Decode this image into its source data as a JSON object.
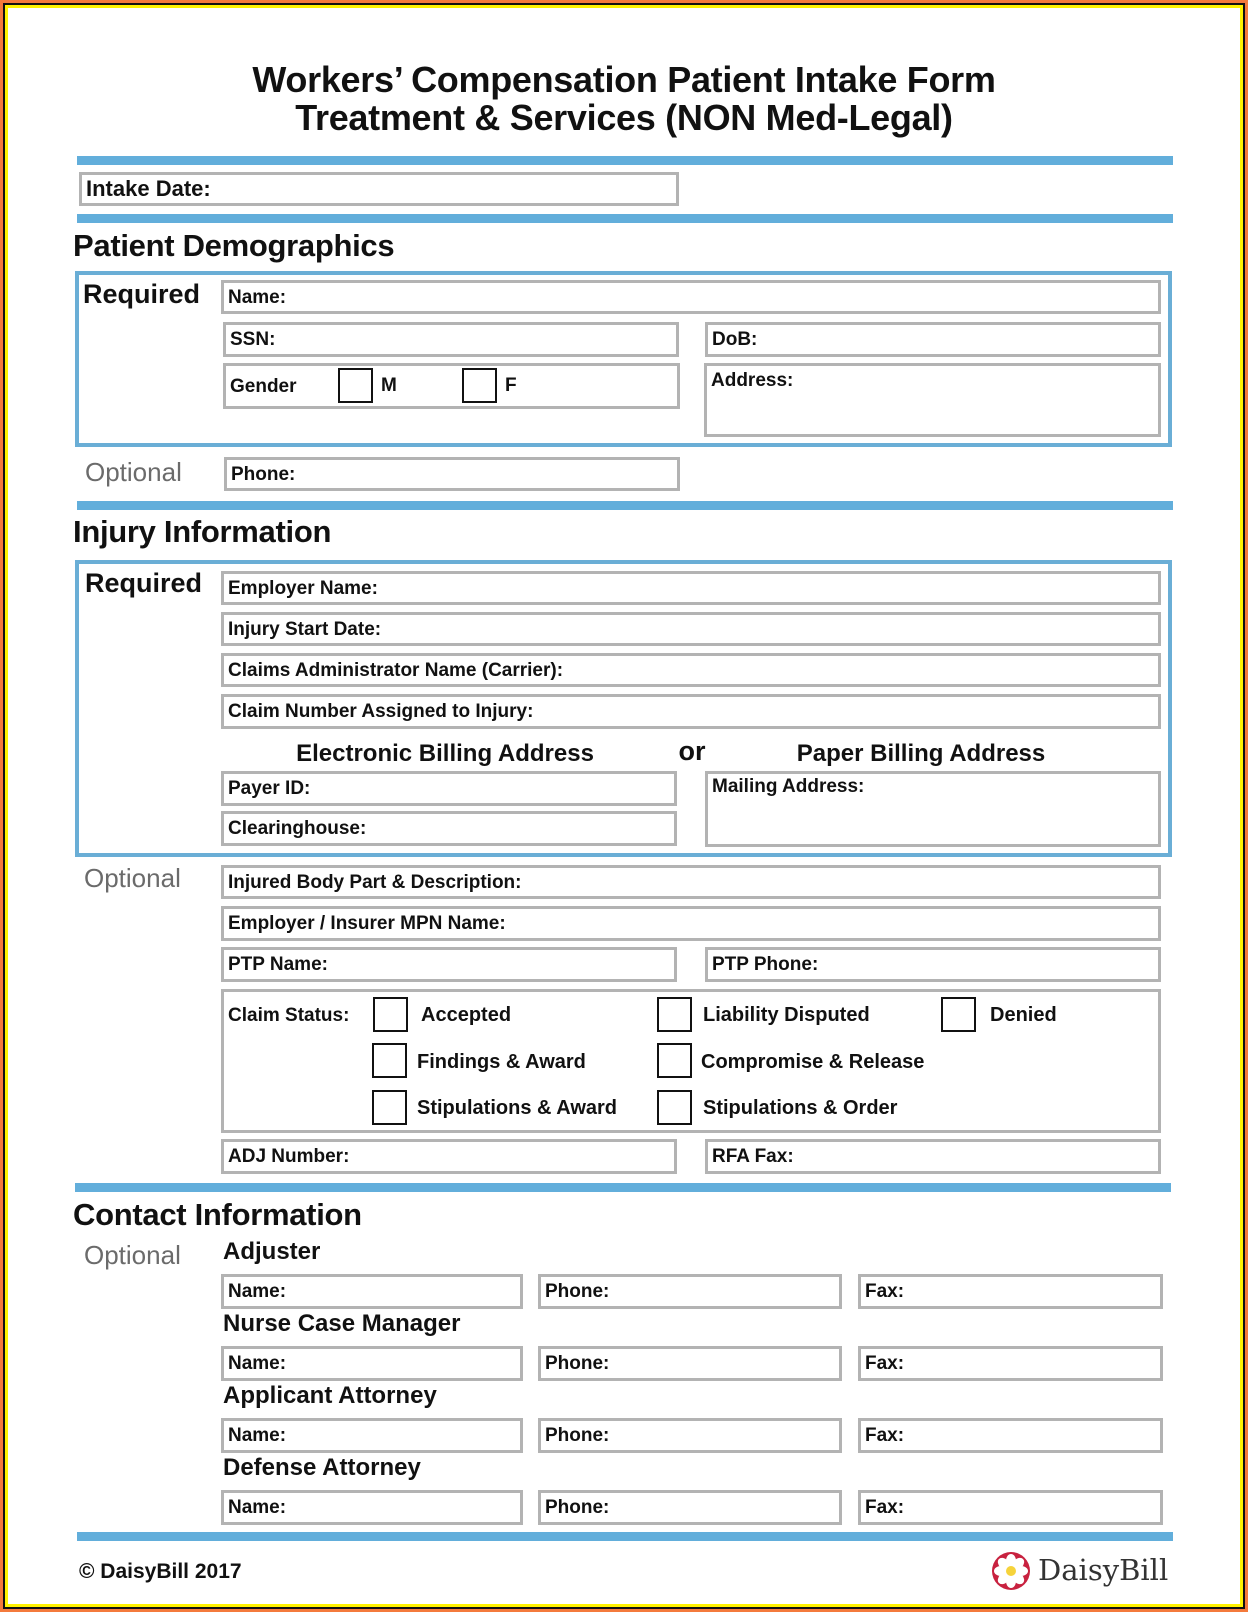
{
  "document": {
    "title_line1": "Workers’ Compensation Patient Intake Form",
    "title_line2": "Treatment & Services (NON Med-Legal)",
    "colors": {
      "accent_bar": "#62aedb",
      "section_box_border": "#6aaed6",
      "field_border": "#b3b3b3",
      "frame_outer": "#f47a3c",
      "frame_inner": "#fff200",
      "optional_text": "#6b6b6b",
      "logo_red": "#c8213f",
      "logo_yellow": "#f6d33b"
    }
  },
  "intake": {
    "intake_date_label": "Intake Date:"
  },
  "demographics": {
    "heading": "Patient Demographics",
    "required_label": "Required",
    "optional_label": "Optional",
    "fields": {
      "name": "Name:",
      "ssn": "SSN:",
      "dob": "DoB:",
      "gender": "Gender",
      "gender_m": "M",
      "gender_f": "F",
      "address": "Address:",
      "phone": "Phone:"
    }
  },
  "injury": {
    "heading": "Injury Information",
    "required_label": "Required",
    "optional_label": "Optional",
    "fields": {
      "employer_name": "Employer Name:",
      "injury_start_date": "Injury Start Date:",
      "claims_admin": "Claims Administrator Name (Carrier):",
      "claim_number": "Claim Number Assigned to Injury:",
      "payer_id": "Payer ID:",
      "clearinghouse": "Clearinghouse:",
      "mailing_address": "Mailing Address:",
      "injured_body_part": "Injured Body Part & Description:",
      "mpn_name": "Employer / Insurer MPN Name:",
      "ptp_name": "PTP Name:",
      "ptp_phone": "PTP Phone:",
      "adj_number": "ADJ Number:",
      "rfa_fax": "RFA Fax:"
    },
    "billing": {
      "electronic_heading": "Electronic Billing Address",
      "or_label": "or",
      "paper_heading": "Paper Billing Address"
    },
    "claim_status": {
      "label": "Claim Status:",
      "options": [
        "Accepted",
        "Liability Disputed",
        "Denied",
        "Findings & Award",
        "Compromise & Release",
        "Stipulations & Award",
        "Stipulations & Order"
      ]
    }
  },
  "contact": {
    "heading": "Contact Information",
    "optional_label": "Optional",
    "groups": [
      {
        "title": "Adjuster",
        "name": "Name:",
        "phone": "Phone:",
        "fax": "Fax:"
      },
      {
        "title": "Nurse Case Manager",
        "name": "Name:",
        "phone": "Phone:",
        "fax": "Fax:"
      },
      {
        "title": "Applicant Attorney",
        "name": "Name:",
        "phone": "Phone:",
        "fax": "Fax:"
      },
      {
        "title": "Defense Attorney",
        "name": "Name:",
        "phone": "Phone:",
        "fax": "Fax:"
      }
    ]
  },
  "footer": {
    "copyright": "© DaisyBill 2017",
    "logo_text": "DaisyBill",
    "logo_icon": "daisy-flower-icon"
  }
}
